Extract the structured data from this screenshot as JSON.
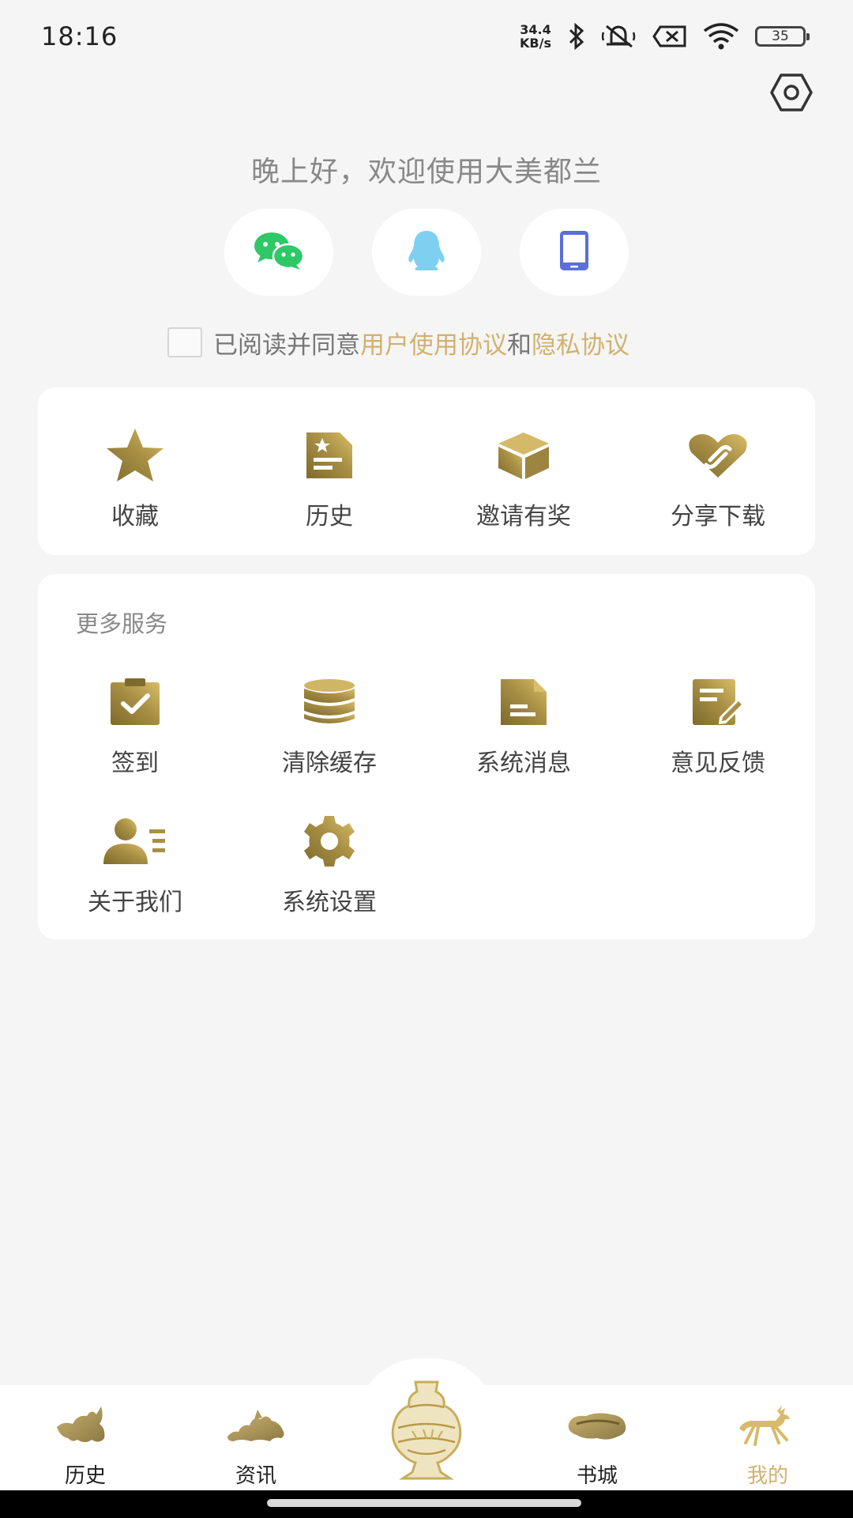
{
  "status_bar": {
    "time": "18:16",
    "speed_value": "34.4",
    "speed_unit": "KB/s",
    "battery": "35"
  },
  "greeting": "晚上好，欢迎使用大美都兰",
  "login_options": [
    {
      "icon": "wechat-icon",
      "color": "#2ec866"
    },
    {
      "icon": "qq-icon",
      "color": "#7fd0f0"
    },
    {
      "icon": "phone-icon",
      "color": "#5a6fd8"
    }
  ],
  "agreement": {
    "prefix": "已阅读并同意",
    "user_agreement": "用户使用协议",
    "and": "和",
    "privacy": "隐私协议"
  },
  "quick_actions": [
    {
      "label": "收藏",
      "icon": "star-icon"
    },
    {
      "label": "历史",
      "icon": "history-doc-icon"
    },
    {
      "label": "邀请有奖",
      "icon": "gift-box-icon"
    },
    {
      "label": "分享下载",
      "icon": "share-heart-icon"
    }
  ],
  "more_services": {
    "title": "更多服务",
    "items": [
      {
        "label": "签到",
        "icon": "clipboard-check-icon"
      },
      {
        "label": "清除缓存",
        "icon": "database-icon"
      },
      {
        "label": "系统消息",
        "icon": "document-icon"
      },
      {
        "label": "意见反馈",
        "icon": "edit-note-icon"
      },
      {
        "label": "关于我们",
        "icon": "user-list-icon"
      },
      {
        "label": "系统设置",
        "icon": "gear-icon"
      }
    ]
  },
  "tabs": [
    {
      "label": "历史",
      "active": false
    },
    {
      "label": "资讯",
      "active": false
    },
    {
      "label": "书城",
      "active": false
    },
    {
      "label": "我的",
      "active": true
    }
  ],
  "colors": {
    "accent_gold": "#d2b16c",
    "icon_gold_dark": "#8a7330",
    "icon_gold_light": "#cfb35c",
    "background": "#f5f5f5"
  }
}
